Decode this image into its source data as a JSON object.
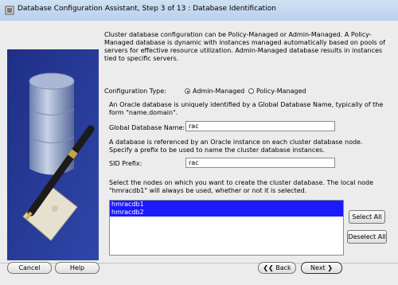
{
  "window": {
    "title": "Database Configuration Assistant, Step 3 of 13 : Database Identification"
  },
  "intro": {
    "text": "Cluster database configuration can be Policy-Managed or Admin-Managed. A Policy-Managed database is dynamic with instances managed automatically based on pools of servers for effective resource utilization. Admin-Managed database results in instances tied to specific servers."
  },
  "config_type": {
    "label": "Configuration Type:",
    "options": [
      "Admin-Managed",
      "Policy-Managed"
    ],
    "selected": "Admin-Managed"
  },
  "global_db": {
    "description": "An Oracle database is uniquely identified by a Global Database Name, typically of the form \"name.domain\".",
    "label": "Global Database Name:",
    "value": "rac"
  },
  "sid": {
    "description": "A database is referenced by an Oracle instance on each cluster database node. Specify a prefix to be used to name the cluster database instances.",
    "label": "SID Prefix:",
    "value": "rac"
  },
  "nodes": {
    "description": "Select the nodes on which you want to create the cluster database. The local node \"hmracdb1\" will always be used, whether or not it is selected.",
    "items": [
      "hmracdb1",
      "hmracdb2"
    ],
    "select_all_label": "Select All",
    "deselect_all_label": "Deselect All"
  },
  "footer": {
    "cancel_label": "Cancel",
    "help_label": "Help",
    "back_label": "Back",
    "next_label": "Next"
  }
}
